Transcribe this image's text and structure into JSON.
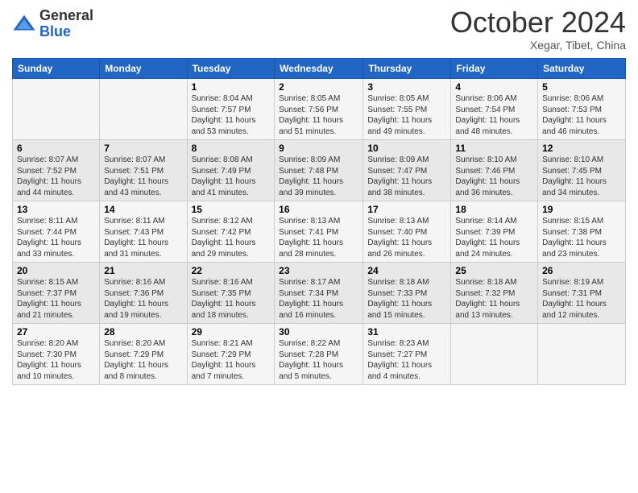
{
  "header": {
    "logo_general": "General",
    "logo_blue": "Blue",
    "month": "October 2024",
    "location": "Xegar, Tibet, China"
  },
  "days_of_week": [
    "Sunday",
    "Monday",
    "Tuesday",
    "Wednesday",
    "Thursday",
    "Friday",
    "Saturday"
  ],
  "weeks": [
    [
      {
        "day": "",
        "info": ""
      },
      {
        "day": "",
        "info": ""
      },
      {
        "day": "1",
        "info": "Sunrise: 8:04 AM\nSunset: 7:57 PM\nDaylight: 11 hours\nand 53 minutes."
      },
      {
        "day": "2",
        "info": "Sunrise: 8:05 AM\nSunset: 7:56 PM\nDaylight: 11 hours\nand 51 minutes."
      },
      {
        "day": "3",
        "info": "Sunrise: 8:05 AM\nSunset: 7:55 PM\nDaylight: 11 hours\nand 49 minutes."
      },
      {
        "day": "4",
        "info": "Sunrise: 8:06 AM\nSunset: 7:54 PM\nDaylight: 11 hours\nand 48 minutes."
      },
      {
        "day": "5",
        "info": "Sunrise: 8:06 AM\nSunset: 7:53 PM\nDaylight: 11 hours\nand 46 minutes."
      }
    ],
    [
      {
        "day": "6",
        "info": "Sunrise: 8:07 AM\nSunset: 7:52 PM\nDaylight: 11 hours\nand 44 minutes."
      },
      {
        "day": "7",
        "info": "Sunrise: 8:07 AM\nSunset: 7:51 PM\nDaylight: 11 hours\nand 43 minutes."
      },
      {
        "day": "8",
        "info": "Sunrise: 8:08 AM\nSunset: 7:49 PM\nDaylight: 11 hours\nand 41 minutes."
      },
      {
        "day": "9",
        "info": "Sunrise: 8:09 AM\nSunset: 7:48 PM\nDaylight: 11 hours\nand 39 minutes."
      },
      {
        "day": "10",
        "info": "Sunrise: 8:09 AM\nSunset: 7:47 PM\nDaylight: 11 hours\nand 38 minutes."
      },
      {
        "day": "11",
        "info": "Sunrise: 8:10 AM\nSunset: 7:46 PM\nDaylight: 11 hours\nand 36 minutes."
      },
      {
        "day": "12",
        "info": "Sunrise: 8:10 AM\nSunset: 7:45 PM\nDaylight: 11 hours\nand 34 minutes."
      }
    ],
    [
      {
        "day": "13",
        "info": "Sunrise: 8:11 AM\nSunset: 7:44 PM\nDaylight: 11 hours\nand 33 minutes."
      },
      {
        "day": "14",
        "info": "Sunrise: 8:11 AM\nSunset: 7:43 PM\nDaylight: 11 hours\nand 31 minutes."
      },
      {
        "day": "15",
        "info": "Sunrise: 8:12 AM\nSunset: 7:42 PM\nDaylight: 11 hours\nand 29 minutes."
      },
      {
        "day": "16",
        "info": "Sunrise: 8:13 AM\nSunset: 7:41 PM\nDaylight: 11 hours\nand 28 minutes."
      },
      {
        "day": "17",
        "info": "Sunrise: 8:13 AM\nSunset: 7:40 PM\nDaylight: 11 hours\nand 26 minutes."
      },
      {
        "day": "18",
        "info": "Sunrise: 8:14 AM\nSunset: 7:39 PM\nDaylight: 11 hours\nand 24 minutes."
      },
      {
        "day": "19",
        "info": "Sunrise: 8:15 AM\nSunset: 7:38 PM\nDaylight: 11 hours\nand 23 minutes."
      }
    ],
    [
      {
        "day": "20",
        "info": "Sunrise: 8:15 AM\nSunset: 7:37 PM\nDaylight: 11 hours\nand 21 minutes."
      },
      {
        "day": "21",
        "info": "Sunrise: 8:16 AM\nSunset: 7:36 PM\nDaylight: 11 hours\nand 19 minutes."
      },
      {
        "day": "22",
        "info": "Sunrise: 8:16 AM\nSunset: 7:35 PM\nDaylight: 11 hours\nand 18 minutes."
      },
      {
        "day": "23",
        "info": "Sunrise: 8:17 AM\nSunset: 7:34 PM\nDaylight: 11 hours\nand 16 minutes."
      },
      {
        "day": "24",
        "info": "Sunrise: 8:18 AM\nSunset: 7:33 PM\nDaylight: 11 hours\nand 15 minutes."
      },
      {
        "day": "25",
        "info": "Sunrise: 8:18 AM\nSunset: 7:32 PM\nDaylight: 11 hours\nand 13 minutes."
      },
      {
        "day": "26",
        "info": "Sunrise: 8:19 AM\nSunset: 7:31 PM\nDaylight: 11 hours\nand 12 minutes."
      }
    ],
    [
      {
        "day": "27",
        "info": "Sunrise: 8:20 AM\nSunset: 7:30 PM\nDaylight: 11 hours\nand 10 minutes."
      },
      {
        "day": "28",
        "info": "Sunrise: 8:20 AM\nSunset: 7:29 PM\nDaylight: 11 hours\nand 8 minutes."
      },
      {
        "day": "29",
        "info": "Sunrise: 8:21 AM\nSunset: 7:29 PM\nDaylight: 11 hours\nand 7 minutes."
      },
      {
        "day": "30",
        "info": "Sunrise: 8:22 AM\nSunset: 7:28 PM\nDaylight: 11 hours\nand 5 minutes."
      },
      {
        "day": "31",
        "info": "Sunrise: 8:23 AM\nSunset: 7:27 PM\nDaylight: 11 hours\nand 4 minutes."
      },
      {
        "day": "",
        "info": ""
      },
      {
        "day": "",
        "info": ""
      }
    ]
  ]
}
